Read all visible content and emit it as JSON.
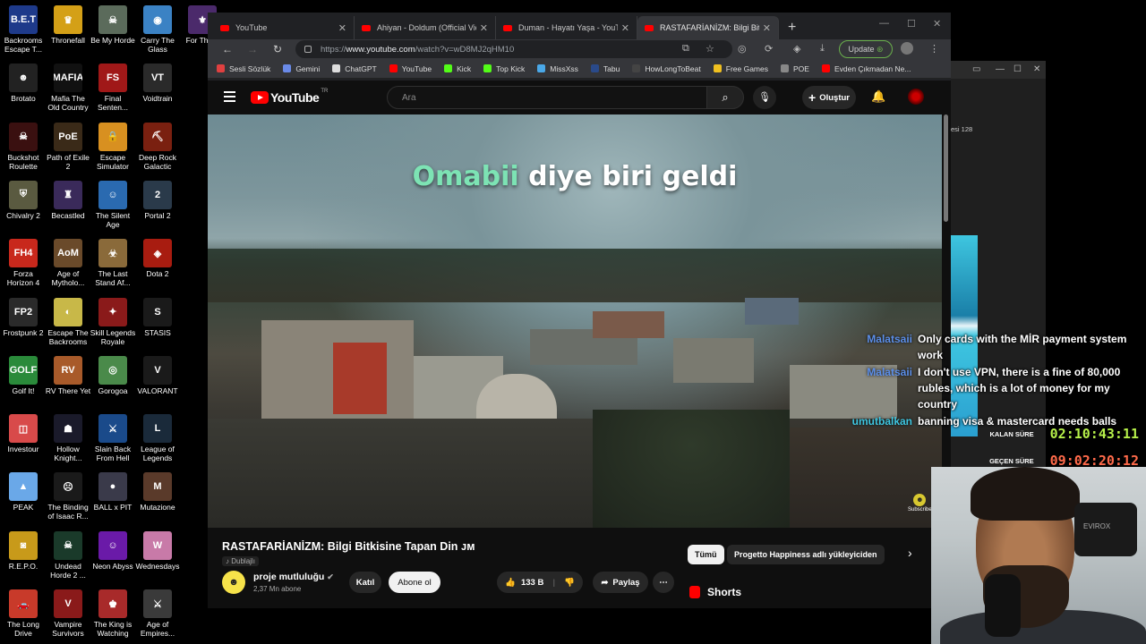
{
  "desktop": {
    "icons": [
      {
        "label": "Backrooms Escape T...",
        "color": "#1e3a8a",
        "glyph": "B.E.T"
      },
      {
        "label": "Thronefall",
        "color": "#d4a017",
        "glyph": "♛"
      },
      {
        "label": "Be My Horde",
        "color": "#5b6b5b",
        "glyph": "☠"
      },
      {
        "label": "Carry The Glass",
        "color": "#3b82c4",
        "glyph": "◉"
      },
      {
        "label": "For The II",
        "color": "#4b2a6b",
        "glyph": "⚜"
      },
      {
        "label": "Brotato",
        "color": "#222222",
        "glyph": "☻"
      },
      {
        "label": "Mafia The Old Country",
        "color": "#111111",
        "glyph": "MAFIA"
      },
      {
        "label": "Final Senten...",
        "color": "#a01818",
        "glyph": "FS"
      },
      {
        "label": "Voidtrain",
        "color": "#2a2a2a",
        "glyph": "VT"
      },
      {
        "label": "Buckshot Roulette",
        "color": "#3a1010",
        "glyph": "☠"
      },
      {
        "label": "Path of Exile 2",
        "color": "#3a2a18",
        "glyph": "PoE"
      },
      {
        "label": "Escape Simulator",
        "color": "#d89020",
        "glyph": "🔒"
      },
      {
        "label": "Deep Rock Galactic",
        "color": "#7a2010",
        "glyph": "⛏"
      },
      {
        "label": "Chivalry 2",
        "color": "#5a5a40",
        "glyph": "⛨"
      },
      {
        "label": "Becastled",
        "color": "#3a2a5a",
        "glyph": "♜"
      },
      {
        "label": "The Silent Age",
        "color": "#2a6ab0",
        "glyph": "☺"
      },
      {
        "label": "Portal 2",
        "color": "#2a3a4a",
        "glyph": "2"
      },
      {
        "label": "Forza Horizon 4",
        "color": "#c8281c",
        "glyph": "FH4"
      },
      {
        "label": "Age of Mytholo...",
        "color": "#6a4a2a",
        "glyph": "AoM"
      },
      {
        "label": "The Last Stand Af...",
        "color": "#8a6a3a",
        "glyph": "☣"
      },
      {
        "label": "Dota 2",
        "color": "#a81c10",
        "glyph": "◈"
      },
      {
        "label": "Frostpunk 2",
        "color": "#2a2a2a",
        "glyph": "FP2"
      },
      {
        "label": "Escape The Backrooms",
        "color": "#c8b848",
        "glyph": "◐"
      },
      {
        "label": "Skill Legends Royale",
        "color": "#8a1a1a",
        "glyph": "✦"
      },
      {
        "label": "STASIS",
        "color": "#1a1a1a",
        "glyph": "S"
      },
      {
        "label": "Golf It!",
        "color": "#2a8a3a",
        "glyph": "GOLF"
      },
      {
        "label": "RV There Yet",
        "color": "#a85a2a",
        "glyph": "RV"
      },
      {
        "label": "Gorogoa",
        "color": "#4a8a4a",
        "glyph": "◎"
      },
      {
        "label": "VALORANT",
        "color": "#1a1a1a",
        "glyph": "V"
      },
      {
        "label": "Investour",
        "color": "#d84a4a",
        "glyph": "◫"
      },
      {
        "label": "Hollow Knight...",
        "color": "#1a1a2a",
        "glyph": "☗"
      },
      {
        "label": "Slain Back From Hell",
        "color": "#1a4a8a",
        "glyph": "⚔"
      },
      {
        "label": "League of Legends",
        "color": "#1a2a3a",
        "glyph": "L"
      },
      {
        "label": "PEAK",
        "color": "#6aa8e8",
        "glyph": "▲"
      },
      {
        "label": "The Binding of Isaac R...",
        "color": "#1a1a1a",
        "glyph": "☹"
      },
      {
        "label": "BALL x PIT",
        "color": "#3a3a4a",
        "glyph": "●"
      },
      {
        "label": "Mutazione",
        "color": "#5a3a2a",
        "glyph": "M"
      },
      {
        "label": "R.E.P.O.",
        "color": "#c89a1a",
        "glyph": "◙"
      },
      {
        "label": "Undead Horde 2 ...",
        "color": "#1a3a2a",
        "glyph": "☠"
      },
      {
        "label": "Neon Abyss",
        "color": "#6a1aa8",
        "glyph": "☺"
      },
      {
        "label": "Wednesdays",
        "color": "#c87aa8",
        "glyph": "W"
      },
      {
        "label": "The Long Drive",
        "color": "#c83a2a",
        "glyph": "🚗"
      },
      {
        "label": "Vampire Survivors",
        "color": "#8a1a1a",
        "glyph": "V"
      },
      {
        "label": "The King is Watching",
        "color": "#a82a2a",
        "glyph": "♚"
      },
      {
        "label": "Age of Empires...",
        "color": "#3a3a3a",
        "glyph": "⚔"
      }
    ]
  },
  "browser": {
    "tabs": [
      {
        "title": "YouTube"
      },
      {
        "title": "Ahiyan - Doldum (Official Video)"
      },
      {
        "title": "Duman - Hayatı Yaşa - YouTube"
      },
      {
        "title": "RASTAFARİANİZM: Bilgi Bitkisine"
      }
    ],
    "url_host": "www.youtube.com",
    "url_prefix": "https://",
    "url_path": "/watch?v=wD8MJ2qHM10",
    "update_label": "Update",
    "bookmarks": [
      {
        "label": "Sesli Sözlük",
        "color": "#e04040"
      },
      {
        "label": "Gemini",
        "color": "#6a8ae8"
      },
      {
        "label": "ChatGPT",
        "color": "#dddddd"
      },
      {
        "label": "YouTube",
        "color": "#ff0000"
      },
      {
        "label": "Kick",
        "color": "#53fc18"
      },
      {
        "label": "Top Kick",
        "color": "#53fc18"
      },
      {
        "label": "MissXss",
        "color": "#4aa8e8"
      },
      {
        "label": "Tabu",
        "color": "#2a4a8a"
      },
      {
        "label": "HowLongToBeat",
        "color": "#444444"
      },
      {
        "label": "Free Games",
        "color": "#f0c020"
      },
      {
        "label": "POE",
        "color": "#888888"
      },
      {
        "label": "Evden Çıkmadan Ne...",
        "color": "#ff0000"
      }
    ]
  },
  "youtube": {
    "logo_word": "YouTube",
    "logo_country": "TR",
    "search_placeholder": "Ara",
    "create_label": "Oluştur",
    "subtitle_highlight": "Omabii",
    "subtitle_rest": " diye biri geldi",
    "subscribe_overlay": "Subscribe",
    "video_title": "RASTAFARİANİZM: Bilgi Bitkisine Tapan Din ᴊᴍ",
    "dubbed_label": "Dublajlı",
    "channel_initial": "☻",
    "channel_name": "proje mutluluğu",
    "channel_subs": "2,37 Mn abone",
    "join_label": "Katıl",
    "subscribe_label": "Abone ol",
    "like_count": "133 B",
    "share_label": "Paylaş",
    "chips": [
      "Tümü",
      "Progetto Happiness adlı yükleyiciden"
    ],
    "shorts_label": "Shorts"
  },
  "bgwindow": {
    "text": "esi 128"
  },
  "chat": [
    {
      "user": "Malatsaii",
      "user_color": "#5b8ee8",
      "text": "Only cards with the MİR payment system work"
    },
    {
      "user": "Malatsaii",
      "user_color": "#5b8ee8",
      "text": "I don't use VPN, there is a fine of 80,000 rubles, which is a lot of money for my country"
    },
    {
      "user": "umutbalkan",
      "user_color": "#3ec6e0",
      "text": "banning visa & mastercard needs balls"
    }
  ],
  "timers": {
    "remaining_label": "KALAN SÜRE",
    "remaining_value": "02:10:43:11",
    "elapsed_label": "GEÇEN SÜRE",
    "elapsed_value": "09:02:20:12"
  },
  "webcam": {
    "headset_text": "EVIROX"
  }
}
